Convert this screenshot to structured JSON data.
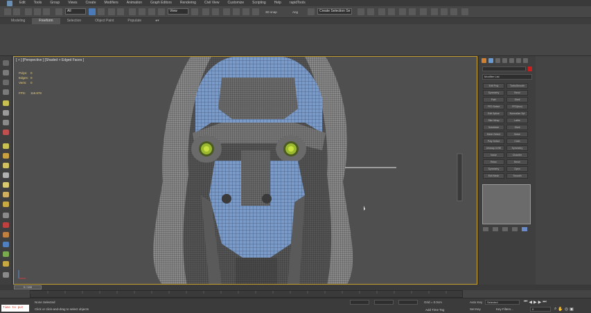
{
  "menu": {
    "items": [
      "Edit",
      "Tools",
      "Group",
      "Views",
      "Create",
      "Modifiers",
      "Animation",
      "Graph Editors",
      "Rendering",
      "Civil View",
      "Customize",
      "Scripting",
      "Help",
      "rapidTools"
    ]
  },
  "toolbar": {
    "filter_value": "All",
    "view_value": "View",
    "selection_set": "Create Selection Se",
    "snap_label": "3D snap",
    "angle_label": "Ang"
  },
  "ribbon": {
    "tabs": [
      "Modeling",
      "Freeform",
      "Selection",
      "Object Paint",
      "Populate"
    ],
    "active_index": 1
  },
  "viewport": {
    "label": "[ + ] [Perspective ] [Shaded + Edged Faces ]",
    "stats": [
      {
        "label": "Polys:",
        "value": "0"
      },
      {
        "label": "Edges:",
        "value": "0"
      },
      {
        "label": "Verts:",
        "value": "0"
      }
    ],
    "fps_label": "FPS:",
    "fps_value": "116.878"
  },
  "command_panel": {
    "modifier_list": "Modifier List",
    "buttons": [
      "Edit Poly",
      "TurboSmooth",
      "Symmetry",
      "Bend",
      "Path",
      "Shell",
      "FFD Select",
      "FFD(box)",
      "Edit Spline",
      "Normalize Spl",
      "Skin Wrap",
      "Lathe",
      "Subdivide",
      "Shell",
      "Mesh Select",
      "Noise",
      "Poly Select",
      "Cloth",
      "Unwrap UVW",
      "Symmetry",
      "Noise",
      "Chamfer",
      "Relax",
      "Bevel",
      "Symmetry",
      "Open",
      "Edit Mesh",
      "Smooth"
    ]
  },
  "timeline": {
    "frame_counter": "0 / 100"
  },
  "status": {
    "selection": "None Selected",
    "prompt": "Click or click-and-drag to select objects",
    "maxscript": "Time to put",
    "grid": "Grid = 0.0cm",
    "auto_key": "Auto Key",
    "set_key": "Set Key",
    "key_mode": "Selected",
    "key_filters": "Key Filters...",
    "add_time_tag": "Add Time Tag",
    "frame": "0"
  },
  "colors": {
    "viewport_border": "#c8a030",
    "active_tool": "#4a7ab8",
    "stats_text": "#e8d080",
    "maxscript_text": "#c83020"
  }
}
